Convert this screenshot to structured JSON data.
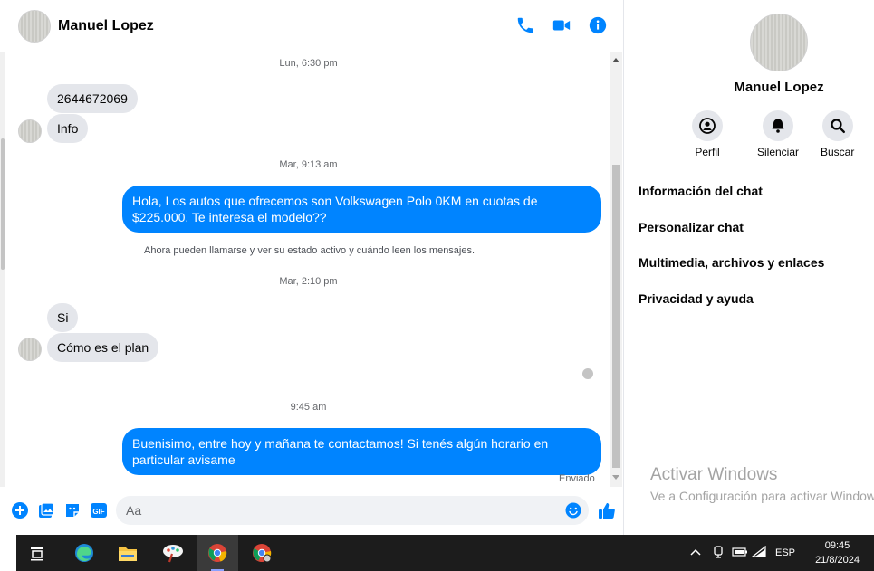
{
  "header": {
    "contact_name": "Manuel Lopez",
    "actions": [
      "phone-icon",
      "video-icon",
      "info-icon"
    ]
  },
  "colors": {
    "accent": "#0084ff",
    "incoming_bubble": "#e4e6eb",
    "taskbar": "#1c1c1c"
  },
  "messages": {
    "ts1": "Lun, 6:30 pm",
    "in1": "2644672069",
    "in2": "Info",
    "ts2": "Mar, 9:13 am",
    "out1": "Hola, Los autos que ofrecemos son Volkswagen Polo 0KM en cuotas de $225.000. Te interesa el modelo??",
    "system_note": "Ahora pueden llamarse y ver su estado activo y cuándo leen los mensajes.",
    "ts3": "Mar, 2:10 pm",
    "in3": "Si",
    "in4": "Cómo es el plan",
    "ts4": "9:45 am",
    "out2": "Buenisimo, entre hoy y mañana te contactamos! Si tenés algún horario en particular avisame",
    "status": "Enviado"
  },
  "composer": {
    "placeholder": "Aa",
    "tools": [
      "plus-icon",
      "image-icon",
      "sticker-icon",
      "gif-icon"
    ],
    "gif_label": "GIF"
  },
  "profile": {
    "name": "Manuel Lopez",
    "actions": [
      {
        "label": "Perfil",
        "icon": "profile-icon"
      },
      {
        "label": "Silenciar",
        "icon": "bell-icon"
      },
      {
        "label": "Buscar",
        "icon": "search-icon"
      }
    ],
    "menu": [
      "Información del chat",
      "Personalizar chat",
      "Multimedia, archivos y enlaces",
      "Privacidad y ayuda"
    ]
  },
  "watermark": {
    "title": "Activar Windows",
    "subtitle": "Ve a Configuración para activar Windows."
  },
  "taskbar": {
    "apps": [
      "task-view-icon",
      "edge-icon",
      "file-explorer-icon",
      "paint-icon",
      "chrome-icon",
      "chrome-profile-icon"
    ],
    "language": "ESP",
    "time": "09:45",
    "date": "21/8/2024"
  }
}
